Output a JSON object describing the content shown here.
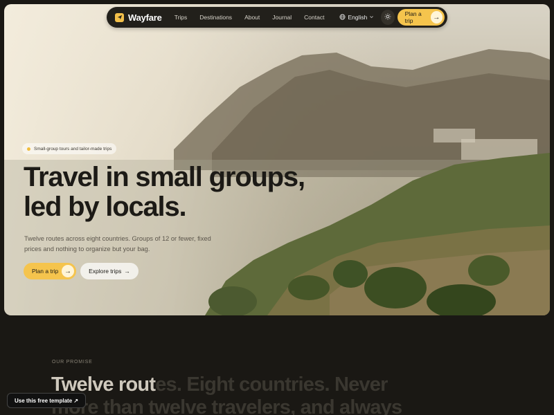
{
  "nav": {
    "brand": "Wayfare",
    "links": [
      "Trips",
      "Destinations",
      "About",
      "Journal",
      "Contact"
    ],
    "language": "English",
    "cta_label": "Plan a trip",
    "cta_arrow": "→"
  },
  "hero": {
    "badge": "Small-group tours and tailor-made trips",
    "headline_line1": "Travel in small groups,",
    "headline_line2": "led by locals.",
    "subtext": "Twelve routes across eight countries. Groups of 12 or fewer, fixed prices and nothing to organize but your bag.",
    "primary_label": "Plan a trip",
    "primary_arrow": "→",
    "secondary_label": "Explore trips",
    "secondary_arrow": "→"
  },
  "promise": {
    "eyebrow": "OUR PROMISE",
    "text_lit": "Twelve rout",
    "text_dim": "es. Eight countries. Never more than twelve travelers, and always"
  },
  "template_button": "Use this free template ↗",
  "colors": {
    "accent": "#f5c44d",
    "dark": "#1a1814",
    "nav_bg": "#22201b"
  }
}
